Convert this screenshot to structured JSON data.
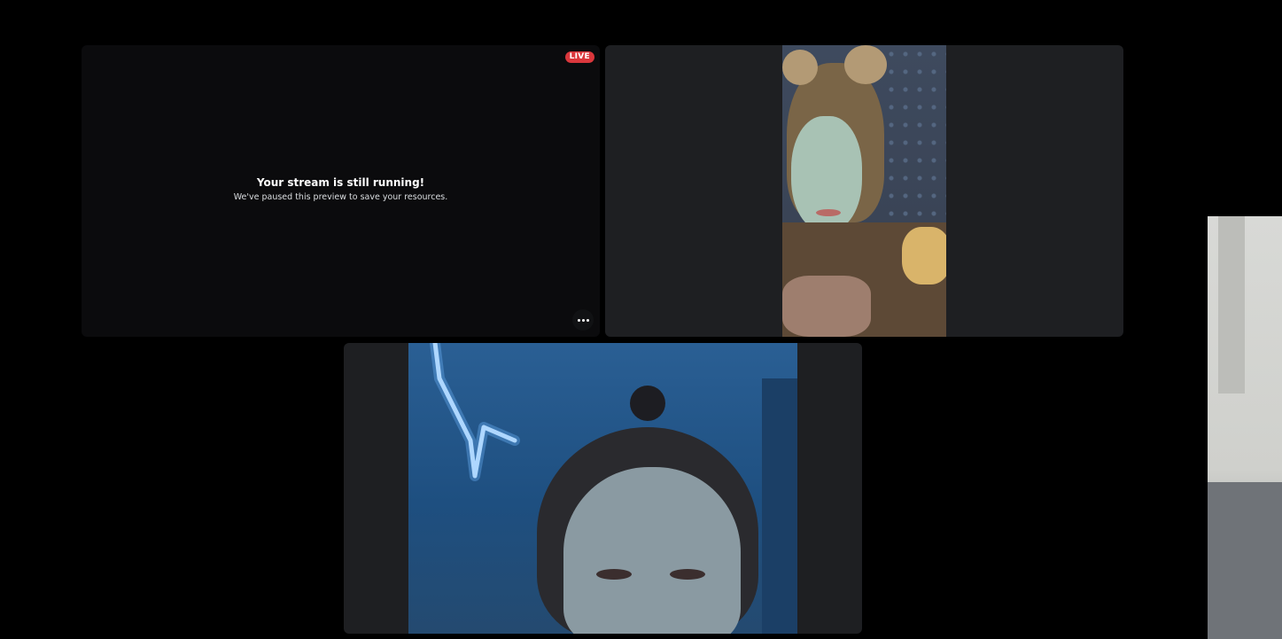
{
  "stream_tile": {
    "live_badge": "LIVE",
    "paused_title": "Your stream is still running!",
    "paused_subtitle": "We've paused this preview to save your resources.",
    "more_icon": "more-horizontal-icon"
  },
  "participants": [
    {
      "role": "camera",
      "description": "video-feed"
    },
    {
      "role": "camera",
      "description": "video-feed"
    },
    {
      "role": "camera",
      "description": "video-feed"
    }
  ],
  "colors": {
    "background": "#000000",
    "tile": "#1e1f22",
    "stream_tile": "#0b0b0d",
    "live_red": "#da373c"
  }
}
